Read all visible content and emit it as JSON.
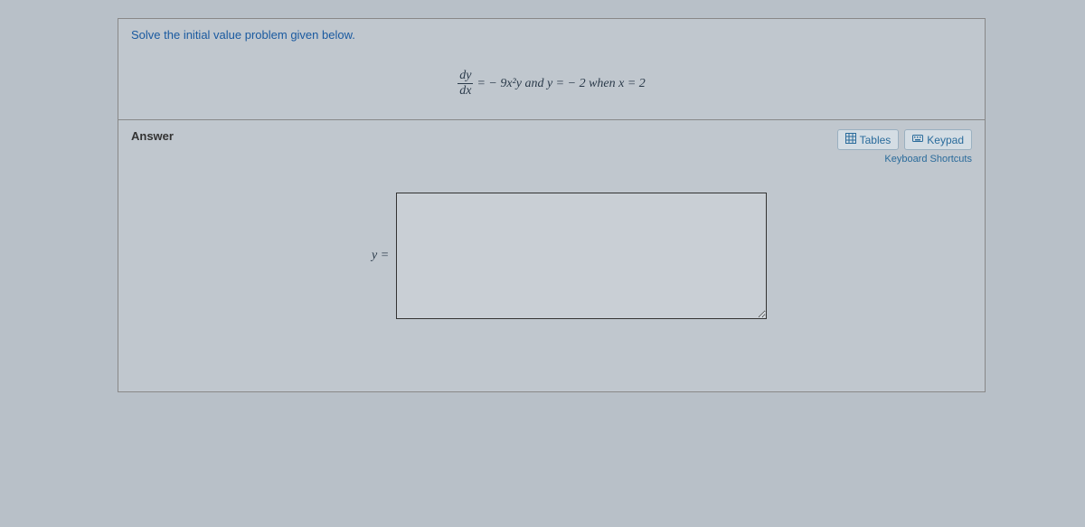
{
  "question": {
    "instruction": "Solve the initial value problem given below.",
    "equation": {
      "frac_top": "dy",
      "frac_bot": "dx",
      "mid": " = − 9x²y and y = − 2 when x = 2"
    }
  },
  "answer": {
    "label": "Answer",
    "y_equals": "y =",
    "value": ""
  },
  "tools": {
    "tables": "Tables",
    "keypad": "Keypad",
    "shortcuts": "Keyboard Shortcuts"
  }
}
